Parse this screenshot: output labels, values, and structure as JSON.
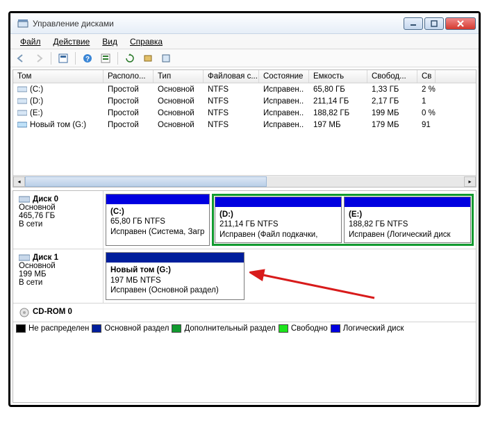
{
  "titlebar": {
    "title": "Управление дисками"
  },
  "menu": {
    "file": "Файл",
    "action": "Действие",
    "view": "Вид",
    "help": "Справка"
  },
  "columns": {
    "tom": "Том",
    "raspolo": "Располо...",
    "tip": "Тип",
    "fs": "Файловая с...",
    "sost": "Состояние",
    "emk": "Емкость",
    "svobod": "Свобод...",
    "sv": "Св"
  },
  "volumes": [
    {
      "name": "(C:)",
      "layout": "Простой",
      "type": "Основной",
      "fs": "NTFS",
      "status": "Исправен..",
      "cap": "65,80 ГБ",
      "free": "1,33 ГБ",
      "pct": "2 %"
    },
    {
      "name": "(D:)",
      "layout": "Простой",
      "type": "Основной",
      "fs": "NTFS",
      "status": "Исправен..",
      "cap": "211,14 ГБ",
      "free": "2,17 ГБ",
      "pct": "1"
    },
    {
      "name": "(E:)",
      "layout": "Простой",
      "type": "Основной",
      "fs": "NTFS",
      "status": "Исправен..",
      "cap": "188,82 ГБ",
      "free": "199 МБ",
      "pct": "0 %"
    },
    {
      "name": "Новый том (G:)",
      "layout": "Простой",
      "type": "Основной",
      "fs": "NTFS",
      "status": "Исправен..",
      "cap": "197 МБ",
      "free": "179 МБ",
      "pct": "91"
    }
  ],
  "disks": {
    "d0": {
      "title": "Диск 0",
      "type": "Основной",
      "size": "465,76 ГБ",
      "state": "В сети",
      "parts": [
        {
          "label": "(C:)",
          "sz": "65,80 ГБ NTFS",
          "st": "Исправен (Система, Загр"
        },
        {
          "label": "(D:)",
          "sz": "211,14 ГБ NTFS",
          "st": "Исправен (Файл подкачки,"
        },
        {
          "label": "(E:)",
          "sz": "188,82 ГБ NTFS",
          "st": "Исправен (Логический диск"
        }
      ]
    },
    "d1": {
      "title": "Диск 1",
      "type": "Основной",
      "size": "199 МБ",
      "state": "В сети",
      "parts": [
        {
          "label": "Новый том  (G:)",
          "sz": "197 МБ NTFS",
          "st": "Исправен (Основной раздел)"
        }
      ]
    },
    "cd": {
      "title": "CD-ROM 0"
    }
  },
  "legend": {
    "unalloc": "Не распределен",
    "primary": "Основной раздел",
    "extended": "Дополнительный раздел",
    "free": "Свободно",
    "logical": "Логический диск"
  }
}
